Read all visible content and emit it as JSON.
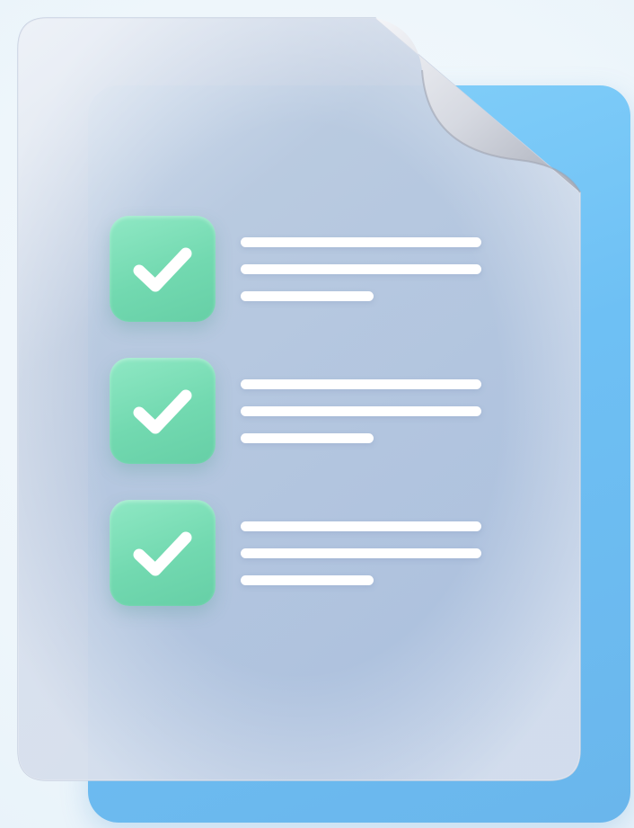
{
  "illustration": {
    "subject": "checklist-document",
    "colors": {
      "background": "#eef6fb",
      "back_sheet": "#75c6f6",
      "front_sheet": "#b6c5dc",
      "check_box": "#76dbb2",
      "check_mark": "#ffffff",
      "text_lines": "#ffffff"
    },
    "items": [
      {
        "checked": true,
        "icon": "checkmark-icon"
      },
      {
        "checked": true,
        "icon": "checkmark-icon"
      },
      {
        "checked": true,
        "icon": "checkmark-icon"
      }
    ]
  }
}
